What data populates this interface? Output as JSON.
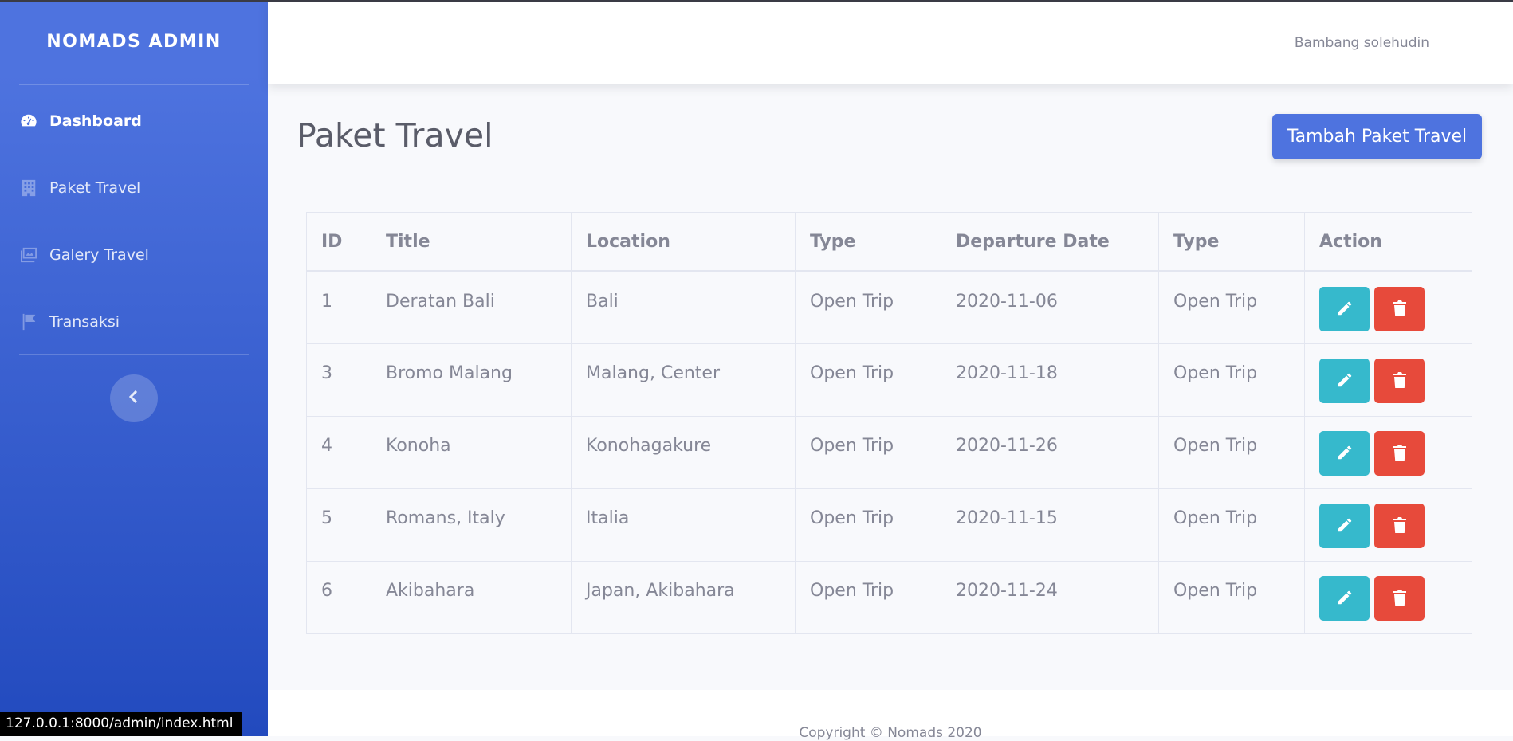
{
  "sidebar": {
    "brand": "NOMADS ADMIN",
    "items": [
      {
        "label": "Dashboard",
        "icon": "tachometer-icon",
        "active": true
      },
      {
        "label": "Paket Travel",
        "icon": "building-icon"
      },
      {
        "label": "Galery Travel",
        "icon": "images-icon"
      },
      {
        "label": "Transaksi",
        "icon": "flag-icon"
      }
    ],
    "toggle_icon": "chevron-left-icon"
  },
  "topbar": {
    "username": "Bambang solehudin"
  },
  "main": {
    "title": "Paket Travel",
    "add_button": "Tambah Paket Travel",
    "table": {
      "headers": [
        "ID",
        "Title",
        "Location",
        "Type",
        "Departure Date",
        "Type",
        "Action"
      ],
      "rows": [
        {
          "id": "1",
          "title": "Deratan Bali",
          "location": "Bali",
          "type": "Open Trip",
          "date": "2020-11-06",
          "type2": "Open Trip"
        },
        {
          "id": "3",
          "title": "Bromo Malang",
          "location": "Malang, Center",
          "type": "Open Trip",
          "date": "2020-11-18",
          "type2": "Open Trip"
        },
        {
          "id": "4",
          "title": "Konoha",
          "location": "Konohagakure",
          "type": "Open Trip",
          "date": "2020-11-26",
          "type2": "Open Trip"
        },
        {
          "id": "5",
          "title": "Romans, Italy",
          "location": "Italia",
          "type": "Open Trip",
          "date": "2020-11-15",
          "type2": "Open Trip"
        },
        {
          "id": "6",
          "title": "Akibahara",
          "location": "Japan, Akibahara",
          "type": "Open Trip",
          "date": "2020-11-24",
          "type2": "Open Trip"
        }
      ],
      "row_actions": {
        "edit_icon": "pencil-icon",
        "delete_icon": "trash-icon"
      }
    }
  },
  "footer": {
    "copyright": "Copyright © Nomads 2020"
  },
  "statusbar": {
    "url": "127.0.0.1:8000/admin/index.html"
  },
  "colors": {
    "primary": "#4e73df",
    "info": "#36b9cc",
    "danger": "#e74a3b",
    "text": "#858796"
  }
}
